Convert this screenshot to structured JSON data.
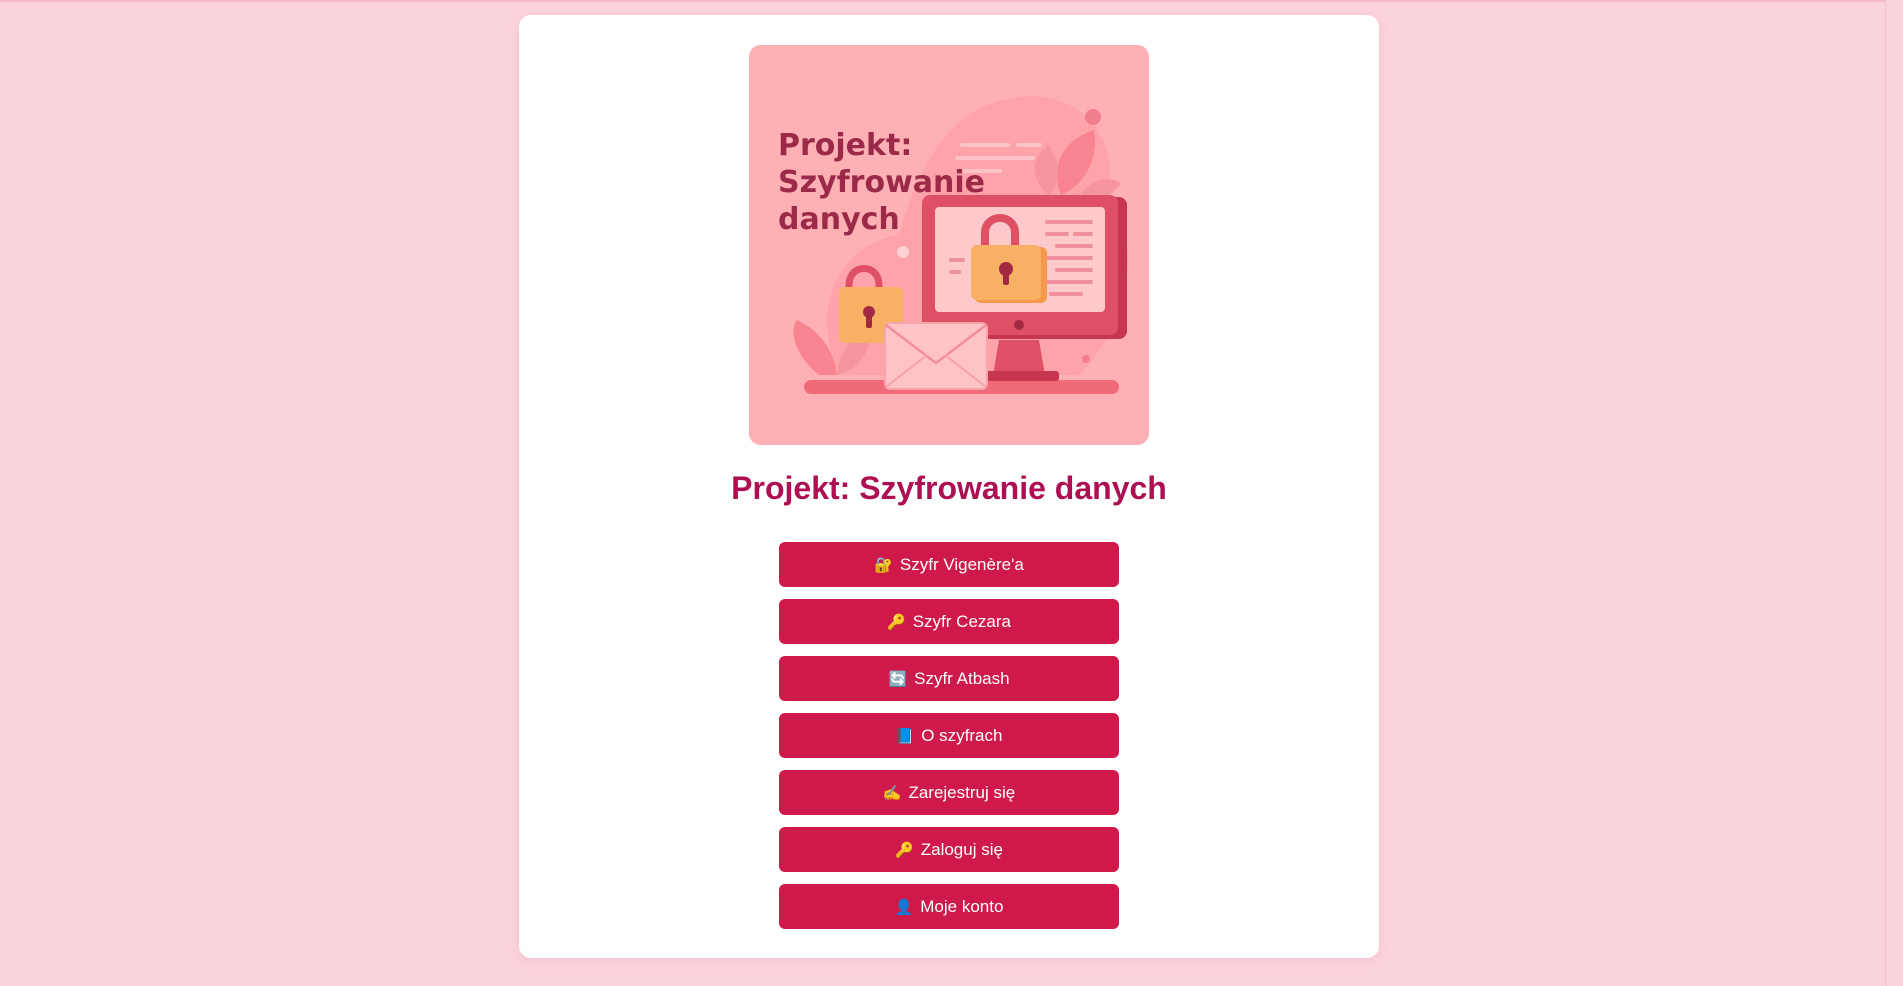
{
  "hero": {
    "title": "Projekt:\nSzyfrowanie\ndanych"
  },
  "page_title": "Projekt: Szyfrowanie danych",
  "menu": {
    "items": [
      {
        "icon": "🔐",
        "icon_name": "locked-with-key-icon",
        "label": "Szyfr Vigenère'a"
      },
      {
        "icon": "🔑",
        "icon_name": "key-icon",
        "label": "Szyfr Cezara"
      },
      {
        "icon": "🔄",
        "icon_name": "arrows-cycle-icon",
        "label": "Szyfr Atbash"
      },
      {
        "icon": "📘",
        "icon_name": "blue-book-icon",
        "label": "O szyfrach"
      },
      {
        "icon": "✍️",
        "icon_name": "writing-hand-icon",
        "label": "Zarejestruj się"
      },
      {
        "icon": "🔑",
        "icon_name": "key-icon",
        "label": "Zaloguj się"
      },
      {
        "icon": "👤",
        "icon_name": "user-silhouette-icon",
        "label": "Moje konto"
      }
    ]
  },
  "colors": {
    "background": "#fbd3dc",
    "card": "#ffffff",
    "accent": "#d0194b",
    "title": "#ad0f52",
    "hero_bg": "#ffb0b5"
  }
}
